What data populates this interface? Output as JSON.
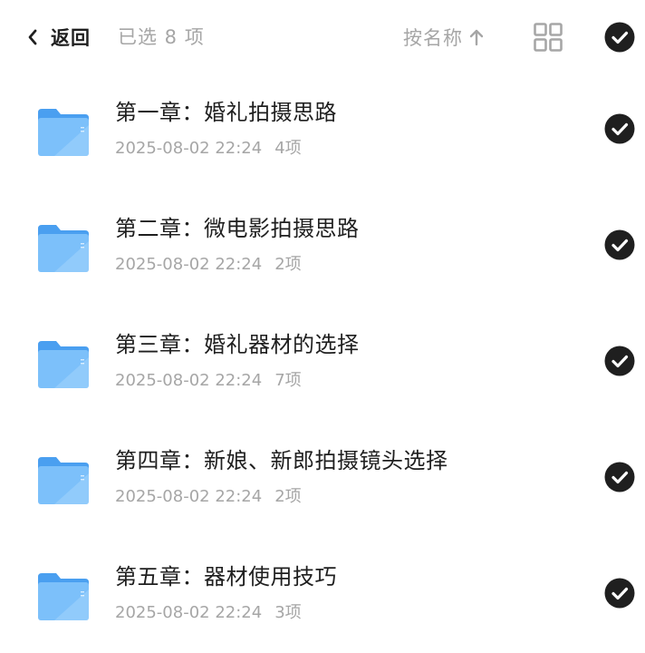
{
  "header": {
    "back_label": "返回",
    "selected_count": "已选 8 项",
    "sort_label": "按名称",
    "sort_direction": "ascending",
    "view_mode": "grid",
    "all_selected": true
  },
  "colors": {
    "primary_text": "#1f1f1f",
    "secondary_text": "#a6a6a6",
    "check_fill": "#1f1f1f",
    "folder_blue": "#5aaef5"
  },
  "files": [
    {
      "name": "第一章：婚礼拍摄思路",
      "date": "2025-08-02 22:24",
      "count": "4项",
      "selected": true,
      "icon": "folder-icon"
    },
    {
      "name": "第二章：微电影拍摄思路",
      "date": "2025-08-02 22:24",
      "count": "2项",
      "selected": true,
      "icon": "folder-icon"
    },
    {
      "name": "第三章：婚礼器材的选择",
      "date": "2025-08-02 22:24",
      "count": "7项",
      "selected": true,
      "icon": "folder-icon"
    },
    {
      "name": "第四章：新娘、新郎拍摄镜头选择",
      "date": "2025-08-02 22:24",
      "count": "2项",
      "selected": true,
      "icon": "folder-icon"
    },
    {
      "name": "第五章：器材使用技巧",
      "date": "2025-08-02 22:24",
      "count": "3项",
      "selected": true,
      "icon": "folder-icon"
    }
  ]
}
